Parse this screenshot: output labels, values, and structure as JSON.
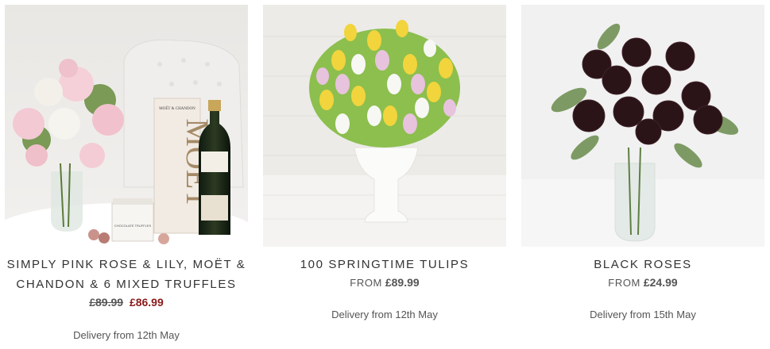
{
  "products": [
    {
      "title": "SIMPLY PINK ROSE & LILY, MOËT & CHANDON & 6 MIXED TRUFFLES",
      "price_old": "£89.99",
      "price_sale": "£86.99",
      "delivery": "Delivery from 12th May",
      "image_text": {
        "box_brand": "MOËT & CHANDON",
        "box_big": "MOËT",
        "truffle_box": "CHOCOLATE TRUFFLES"
      }
    },
    {
      "title": "100 SPRINGTIME TULIPS",
      "price_prefix": "FROM",
      "price": "£89.99",
      "delivery": "Delivery from 12th May"
    },
    {
      "title": "BLACK ROSES",
      "price_prefix": "FROM",
      "price": "£24.99",
      "delivery": "Delivery from 15th May"
    }
  ],
  "colors": {
    "sale_price": "#8b1a1a",
    "text": "#333333"
  }
}
